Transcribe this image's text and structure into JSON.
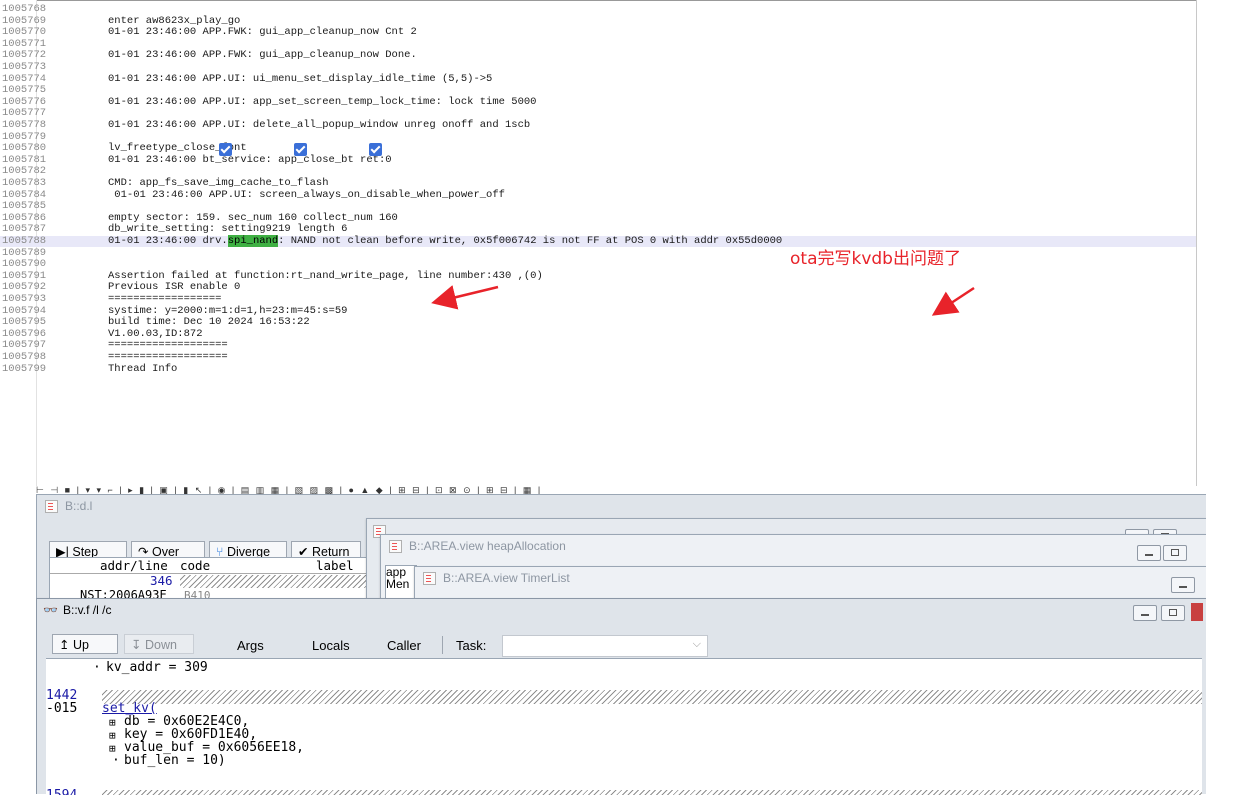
{
  "log": {
    "lines": [
      {
        "n": "1005768",
        "t": ""
      },
      {
        "n": "1005769",
        "t": "enter aw8623x_play_go"
      },
      {
        "n": "1005770",
        "t": "01-01 23:46:00 APP.FWK: gui_app_cleanup_now Cnt 2"
      },
      {
        "n": "1005771",
        "t": ""
      },
      {
        "n": "1005772",
        "t": "01-01 23:46:00 APP.FWK: gui_app_cleanup_now Done."
      },
      {
        "n": "1005773",
        "t": ""
      },
      {
        "n": "1005774",
        "t": "01-01 23:46:00 APP.UI: ui_menu_set_display_idle_time (5,5)->5"
      },
      {
        "n": "1005775",
        "t": ""
      },
      {
        "n": "1005776",
        "t": "01-01 23:46:00 APP.UI: app_set_screen_temp_lock_time: lock time 5000"
      },
      {
        "n": "1005777",
        "t": ""
      },
      {
        "n": "1005778",
        "t": "01-01 23:46:00 APP.UI: delete_all_popup_window unreg onoff and 1scb"
      },
      {
        "n": "1005779",
        "t": ""
      },
      {
        "n": "1005780",
        "t": "lv_freetype_close_font"
      },
      {
        "n": "1005781",
        "t": "01-01 23:46:00 bt_service: app_close_bt ret:0"
      },
      {
        "n": "1005782",
        "t": ""
      },
      {
        "n": "1005783",
        "t": "CMD: app_fs_save_img_cache_to_flash"
      },
      {
        "n": "1005784",
        "t": " 01-01 23:46:00 APP.UI: screen_always_on_disable_when_power_off"
      },
      {
        "n": "1005785",
        "t": ""
      },
      {
        "n": "1005786",
        "t": "empty sector: 159. sec_num 160 collect_num 160"
      },
      {
        "n": "1005787",
        "t": "db_write_setting: setting9219 length 6"
      },
      {
        "n": "1005788",
        "t": ""
      },
      {
        "n": "1005789",
        "t": ""
      },
      {
        "n": "1005790",
        "t": ""
      },
      {
        "n": "1005791",
        "t": "Assertion failed at function:rt_nand_write_page, line number:430 ,(0)"
      },
      {
        "n": "1005792",
        "t": "Previous ISR enable 0"
      },
      {
        "n": "1005793",
        "t": "=================="
      },
      {
        "n": "1005794",
        "t": "systime: y=2000:m=1:d=1,h=23:m=45:s=59"
      },
      {
        "n": "1005795",
        "t": "build time: Dec 10 2024 16:53:22"
      },
      {
        "n": "1005796",
        "t": "V1.00.03,ID:872"
      },
      {
        "n": "1005797",
        "t": "==================="
      },
      {
        "n": "1005798",
        "t": "==================="
      },
      {
        "n": "1005799",
        "t": "Thread Info"
      }
    ],
    "highlight": {
      "pre": "01-01 23:46:00 drv.",
      "word": "spi_nand",
      "post": ": NAND not clean before write, 0x5f006742 is not FF at POS 0 with addr 0x55d0000"
    },
    "toolbar_glyphs": "⊢ ⊣ ■ | ▾ ▾ ⌐ | ▸ ▮ | ▣ | ▮ ↖ | ◉ | ▤ ▥ ▦ | ▧ ▨ ▩ | ● ▲ ◆ | ⊞ ⊟ | ⊡ ⊠ ⊙ | ⊞ ⊟ | ▦ |"
  },
  "annotation": "ota完写kvdb出问题了",
  "colors": {
    "annotation": "#e8232a",
    "highlight_word": "#3fb043",
    "checkbox": "#3a6fd8"
  },
  "dl_window": {
    "title": "B::d.l",
    "buttons": [
      "Step",
      "Over",
      "Diverge",
      "Return"
    ],
    "headers": {
      "addr": "addr/line",
      "code": "code",
      "label": "label"
    },
    "row_line": "346",
    "row_addr": "NST:2006A93E",
    "row_code": "B410"
  },
  "heap_window": {
    "title": "B::AREA.view heapAllocation",
    "partial": [
      "app",
      "Men"
    ]
  },
  "timer_window": {
    "title": "B::AREA.view TimerList"
  },
  "vf_window": {
    "title": "B::v.f /l /c",
    "buttons": {
      "up": "Up",
      "down": "Down"
    },
    "checks": {
      "args": "Args",
      "locals": "Locals",
      "caller": "Caller"
    },
    "task_label": "Task:",
    "task_value": "",
    "frame_local": "kv_addr = 309",
    "frame_line": "1442",
    "frame_offset": "-015",
    "func": "set_kv(",
    "args": [
      "db = 0x60E2E4C0,",
      "key = 0x60FD1E40,",
      "value_buf = 0x6056EE18,",
      "buf_len = 10)"
    ],
    "next_line": "1594"
  }
}
